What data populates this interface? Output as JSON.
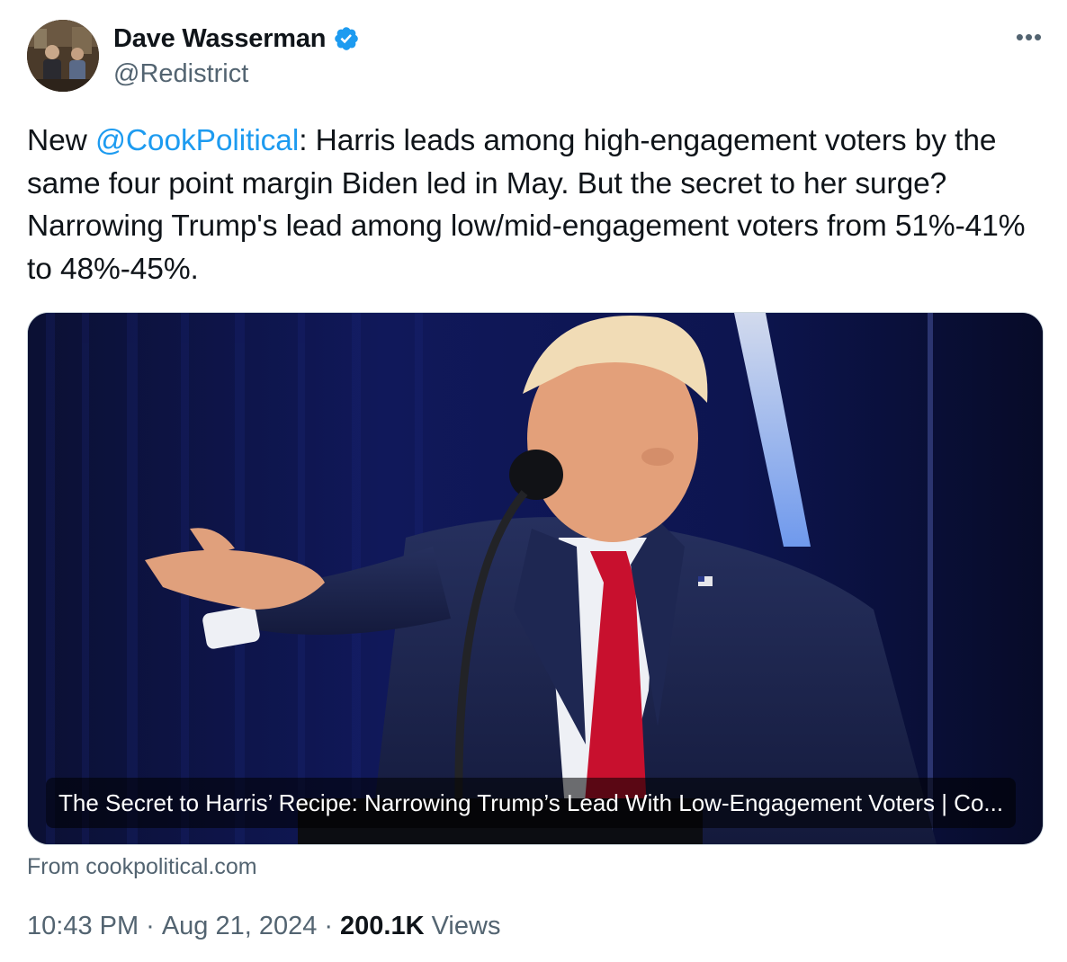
{
  "author": {
    "name": "Dave Wasserman",
    "handle": "@Redistrict",
    "verified_icon": "verified-badge-icon",
    "verified_color": "#1d9bf0"
  },
  "more_icon": "more-options-icon",
  "tweet": {
    "text_prefix": "New ",
    "mention": "@CookPolitical",
    "text_body": ": Harris leads among high-engagement voters by the same four point margin Biden led in May. But the secret to her surge? Narrowing Trump's lead among low/mid-engagement voters from 51%-41% to 48%-45%."
  },
  "card": {
    "title": "The Secret to Harris’ Recipe: Narrowing Trump’s Lead With Low-Engagement Voters | Co...",
    "source": "From cookpolitical.com"
  },
  "meta": {
    "time": "10:43 PM",
    "separator": "·",
    "date": "Aug 21, 2024",
    "views_count": "200.1K",
    "views_label": "Views"
  },
  "colors": {
    "link": "#1d9bf0",
    "secondary_text": "#536471",
    "primary_text": "#0f1419"
  }
}
